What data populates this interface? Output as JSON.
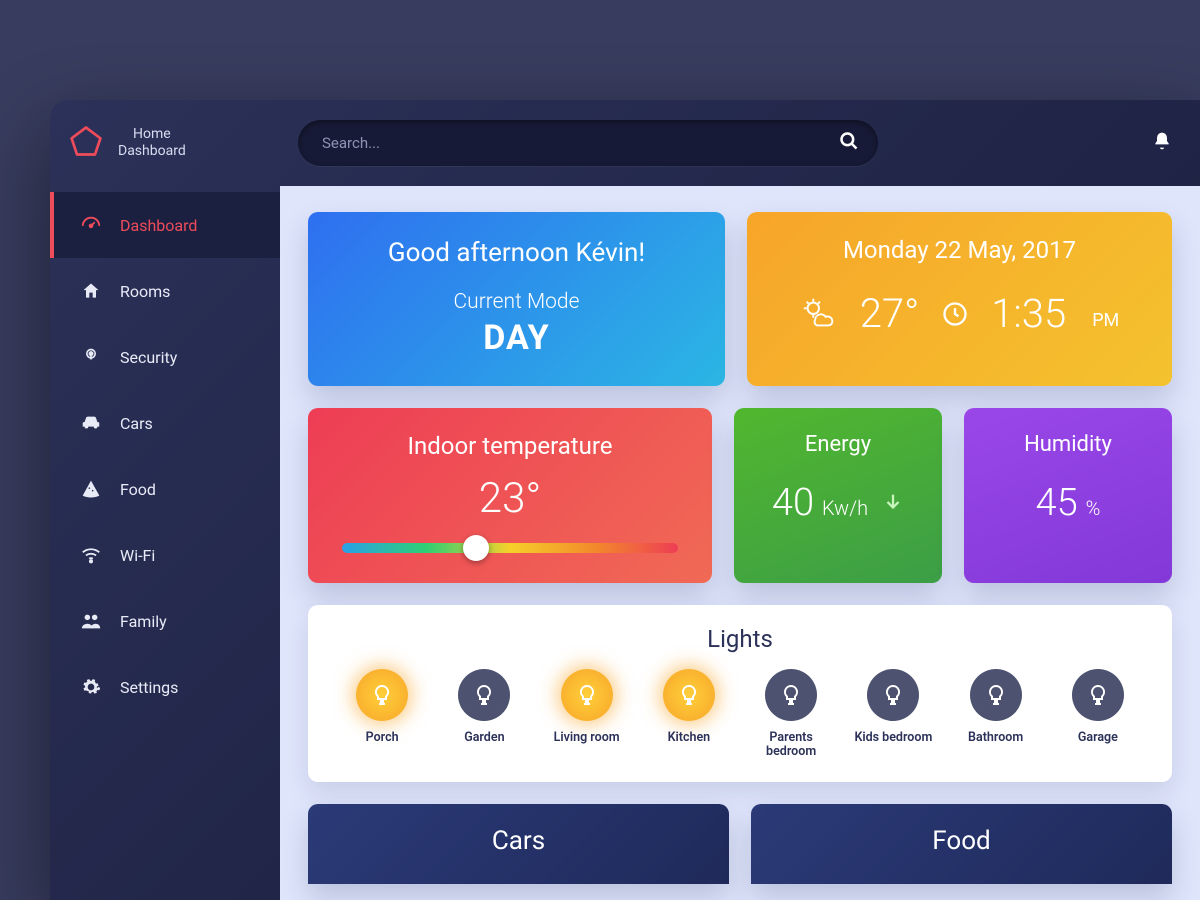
{
  "brand": {
    "line1": "Home",
    "line2": "Dashboard"
  },
  "search": {
    "placeholder": "Search..."
  },
  "sidebar": {
    "items": [
      {
        "label": "Dashboard",
        "icon": "gauge-icon",
        "active": true
      },
      {
        "label": "Rooms",
        "icon": "home-icon",
        "active": false
      },
      {
        "label": "Security",
        "icon": "lock-icon",
        "active": false
      },
      {
        "label": "Cars",
        "icon": "car-icon",
        "active": false
      },
      {
        "label": "Food",
        "icon": "pizza-icon",
        "active": false
      },
      {
        "label": "Wi-Fi",
        "icon": "wifi-icon",
        "active": false
      },
      {
        "label": "Family",
        "icon": "people-icon",
        "active": false
      },
      {
        "label": "Settings",
        "icon": "gear-icon",
        "active": false
      }
    ]
  },
  "greet": {
    "hello": "Good afternoon Kévin!",
    "mode_label": "Current Mode",
    "mode_value": "DAY"
  },
  "datecard": {
    "date": "Monday 22 May, 2017",
    "temp": "27°",
    "time": "1:35",
    "ampm": "PM"
  },
  "indoor": {
    "title": "Indoor temperature",
    "value": "23°"
  },
  "energy": {
    "title": "Energy",
    "value": "40",
    "unit": "Kw/h"
  },
  "humidity": {
    "title": "Humidity",
    "value": "45",
    "unit": "%"
  },
  "lights": {
    "title": "Lights",
    "items": [
      {
        "label": "Porch",
        "on": true
      },
      {
        "label": "Garden",
        "on": false
      },
      {
        "label": "Living room",
        "on": true
      },
      {
        "label": "Kitchen",
        "on": true
      },
      {
        "label": "Parents bedroom",
        "on": false
      },
      {
        "label": "Kids bedroom",
        "on": false
      },
      {
        "label": "Bathroom",
        "on": false
      },
      {
        "label": "Garage",
        "on": false
      }
    ]
  },
  "bottom": {
    "cars": "Cars",
    "food": "Food"
  },
  "colors": {
    "accent": "#ee4b5b"
  }
}
